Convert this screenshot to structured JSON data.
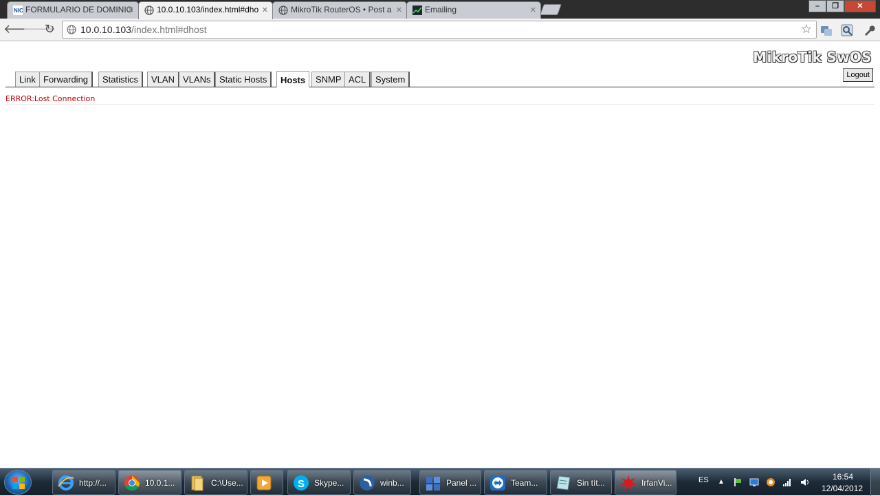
{
  "browser": {
    "tabs": [
      {
        "title": "FORMULARIO DE DOMINIO",
        "icon": "nic-favicon-icon"
      },
      {
        "title": "10.0.10.103/index.html#dho",
        "icon": "globe-icon"
      },
      {
        "title": "MikroTik RouterOS • Post a",
        "icon": "globe-icon"
      },
      {
        "title": "Emailing",
        "icon": "chart-favicon-icon"
      }
    ],
    "url_host": "10.0.10.103",
    "url_path": "/index.html#dhost"
  },
  "page": {
    "brand": "MikroTik SwOS",
    "logout_label": "Logout",
    "nav_tabs": [
      "Link",
      "Forwarding",
      "Statistics",
      "VLAN",
      "VLANs",
      "Static Hosts",
      "Hosts",
      "SNMP",
      "ACL",
      "System"
    ],
    "active_tab": "Hosts",
    "error": "ERROR:Lost Connection"
  },
  "taskbar": {
    "items": [
      {
        "label": "http://...",
        "icon": "internet-explorer-icon"
      },
      {
        "label": "10.0.1...",
        "icon": "chrome-icon",
        "active": true
      },
      {
        "label": "C:\\Use...",
        "icon": "folder-icon"
      },
      {
        "label": "",
        "icon": "media-player-icon"
      },
      {
        "label": "Skype...",
        "icon": "skype-icon"
      },
      {
        "label": "winb...",
        "icon": "winbox-icon"
      },
      {
        "label": "Panel ...",
        "icon": "panel-icon"
      },
      {
        "label": "Team...",
        "icon": "teamviewer-icon"
      },
      {
        "label": "Sin tít...",
        "icon": "notepad-icon"
      },
      {
        "label": "IrfanVi...",
        "icon": "irfanview-icon"
      }
    ],
    "language": "ES",
    "time": "16:54",
    "date": "12/04/2012"
  },
  "colors": {
    "error": "#c00000",
    "titlebar": "#2d2d2d",
    "taskbar": "#1d2b38"
  }
}
